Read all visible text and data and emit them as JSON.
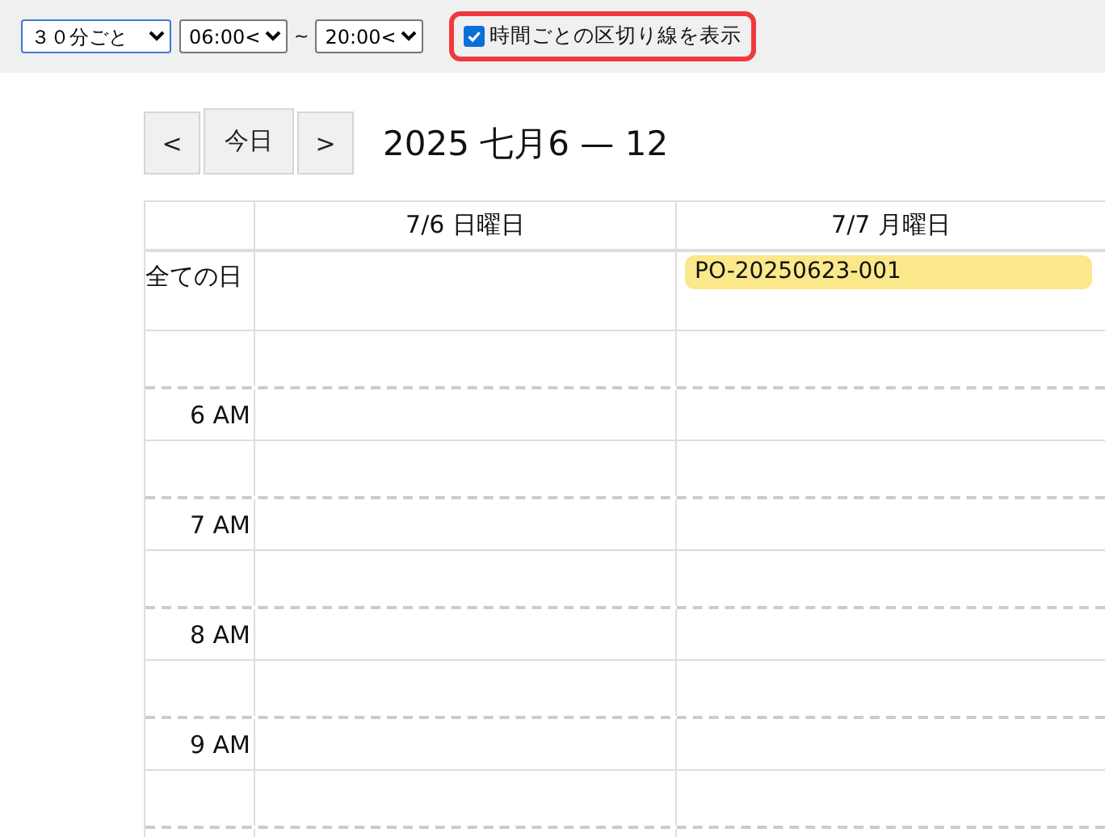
{
  "toolbar": {
    "interval_select": "３０分ごと",
    "start_select": "06:00<",
    "separator": "~",
    "end_select": "20:00<",
    "hour_lines_checkbox": {
      "label": "時間ごとの区切り線を表示",
      "checked": true
    }
  },
  "nav": {
    "prev": "<",
    "today": "今日",
    "next": ">",
    "title": "2025 七月6 — 12"
  },
  "calendar": {
    "columns": [
      {
        "header": "7/6 日曜日"
      },
      {
        "header": "7/7 月曜日",
        "all_day_events": [
          {
            "title": "PO-20250623-001",
            "color": "#fae88a"
          }
        ]
      }
    ],
    "all_day_label": "全ての日",
    "hours": [
      "6 AM",
      "7 AM",
      "8 AM",
      "9 AM"
    ],
    "hour_lines": true
  }
}
